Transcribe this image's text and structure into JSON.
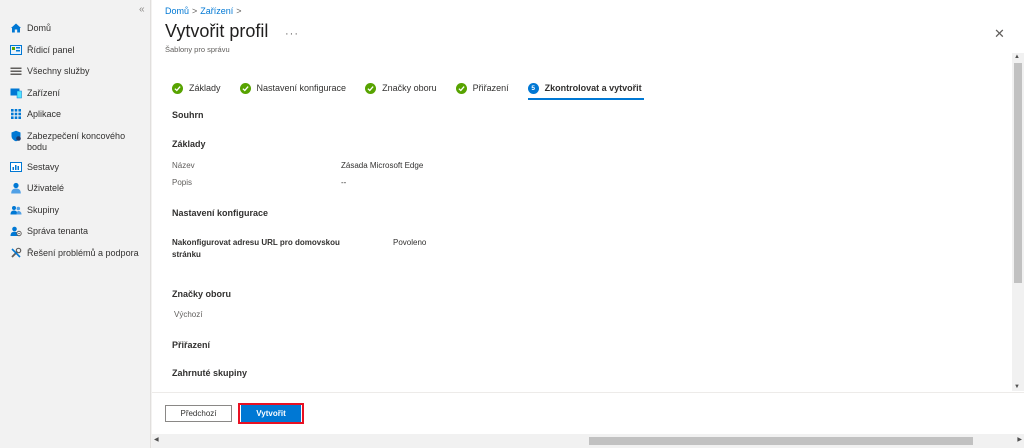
{
  "sidebar": {
    "collapse_icon": "«",
    "items": [
      {
        "label": "Domů",
        "icon": "home-icon"
      },
      {
        "label": "Řídicí panel",
        "icon": "dashboard-icon"
      },
      {
        "label": "Všechny služby",
        "icon": "list-icon"
      },
      {
        "label": "Zařízení",
        "icon": "devices-icon"
      },
      {
        "label": "Aplikace",
        "icon": "apps-grid-icon"
      },
      {
        "label": "Zabezpečení koncového bodu",
        "icon": "shield-icon"
      },
      {
        "label": "Sestavy",
        "icon": "reports-icon"
      },
      {
        "label": "Uživatelé",
        "icon": "user-icon"
      },
      {
        "label": "Skupiny",
        "icon": "group-icon"
      },
      {
        "label": "Správa tenanta",
        "icon": "tenant-icon"
      },
      {
        "label": "Řešení problémů a podpora",
        "icon": "tools-icon"
      }
    ]
  },
  "breadcrumb": {
    "items": [
      "Domů",
      "Zařízení"
    ],
    "separator": ">"
  },
  "header": {
    "title": "Vytvořit profil",
    "more": "···",
    "subtitle": "Šablony pro správu",
    "close": "✕"
  },
  "steps": [
    {
      "label": "Základy",
      "state": "done"
    },
    {
      "label": "Nastavení konfigurace",
      "state": "done"
    },
    {
      "label": "Značky oboru",
      "state": "done"
    },
    {
      "label": "Přiřazení",
      "state": "done"
    },
    {
      "label": "Zkontrolovat a vytvořit",
      "state": "active",
      "number": "5"
    }
  ],
  "summary": {
    "heading": "Souhrn",
    "basics": {
      "heading": "Základy",
      "name_label": "Název",
      "name_value": "Zásada Microsoft Edge",
      "desc_label": "Popis",
      "desc_value": "--"
    },
    "config": {
      "heading": "Nastavení konfigurace",
      "setting_label": "Nakonfigurovat adresu URL pro domovskou stránku",
      "setting_value": "Povoleno"
    },
    "scope": {
      "heading": "Značky oboru",
      "value": "Výchozí"
    },
    "assignments": {
      "heading": "Přiřazení",
      "included_heading": "Zahrnuté skupiny"
    }
  },
  "footer": {
    "prev_label": "Předchozí",
    "create_label": "Vytvořit"
  },
  "colors": {
    "accent": "#0078d4",
    "success": "#57a300",
    "highlight": "#e81123"
  }
}
